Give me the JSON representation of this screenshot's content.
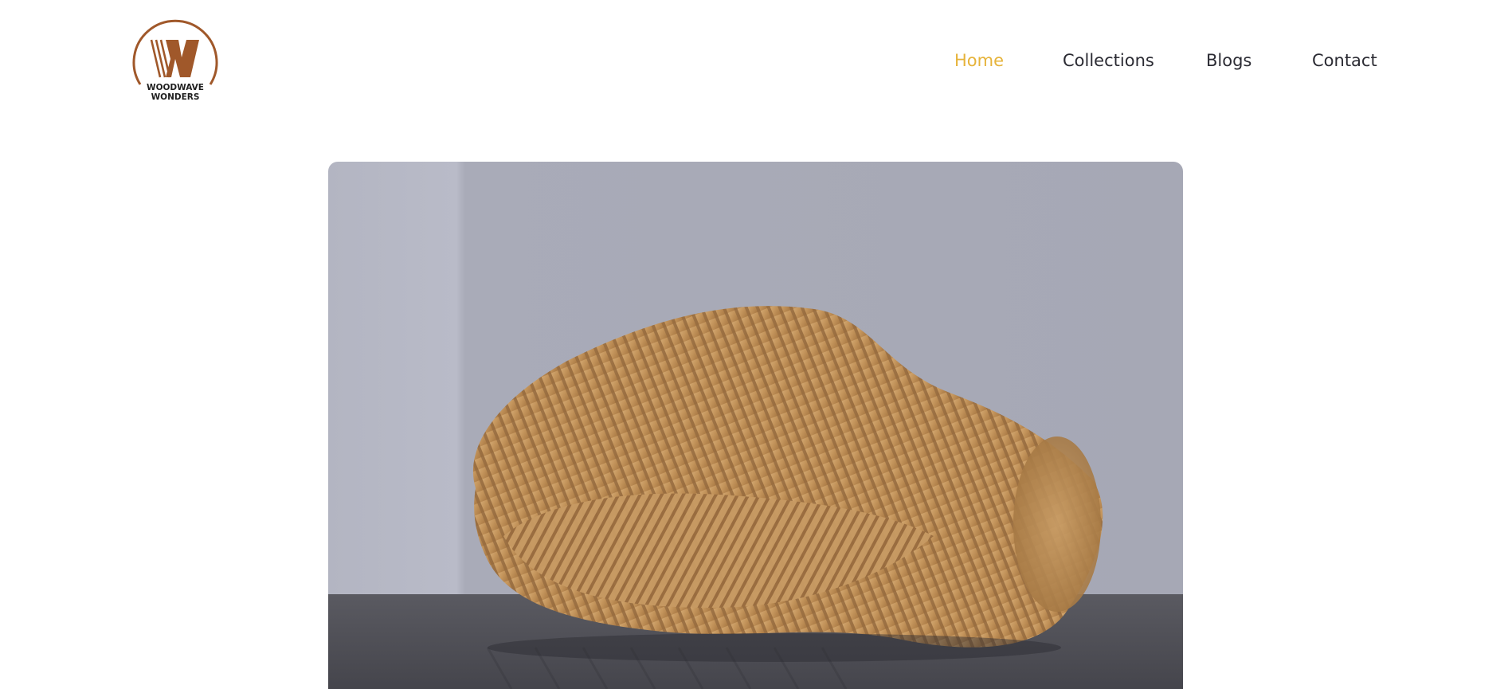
{
  "brand": {
    "line1": "WOODWAVE",
    "line2": "WONDERS",
    "monogram": "W",
    "color": "#a0582a"
  },
  "nav": {
    "items": [
      {
        "label": "Home",
        "active": true
      },
      {
        "label": "Collections",
        "active": false
      },
      {
        "label": "Blogs",
        "active": false
      },
      {
        "label": "Contact",
        "active": false
      }
    ],
    "active_color": "#e6b33a",
    "text_color": "#2b2b33"
  },
  "hero": {
    "image": "parametric-wooden-sofa-photo",
    "wall_color": "#a9abb8",
    "floor_color": "#4f4f56",
    "wood_color": "#c79a63"
  }
}
